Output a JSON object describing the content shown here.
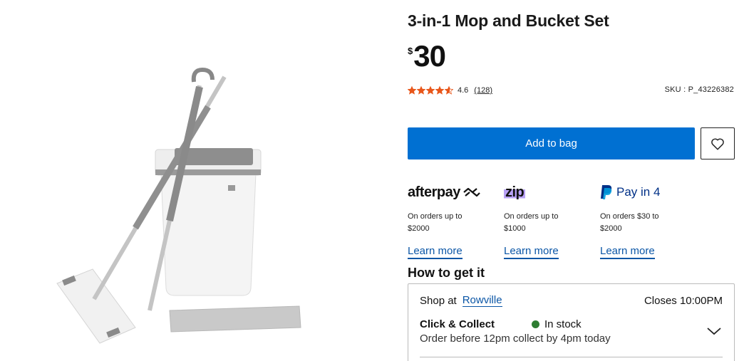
{
  "product": {
    "title": "3-in-1 Mop and Bucket Set",
    "currency_symbol": "$",
    "price": "30",
    "rating": "4.6",
    "rating_value": 4.6,
    "rating_max": 5,
    "review_count": "(128)",
    "sku": "SKU : P_43226382"
  },
  "actions": {
    "add_to_bag": "Add to bag"
  },
  "payments": [
    {
      "name": "afterpay",
      "logo_text": "afterpay",
      "description": "On orders up to $2000",
      "link": "Learn more"
    },
    {
      "name": "zip",
      "logo_text": "zip",
      "description": "On orders up to $1000",
      "link": "Learn more"
    },
    {
      "name": "paypal",
      "logo_text": "Pay in 4",
      "description": "On orders $30 to $2000",
      "link": "Learn more"
    }
  ],
  "fulfilment": {
    "heading": "How to get it",
    "shop_at": "Shop at",
    "store": "Rowville",
    "closes": "Closes 10:00PM",
    "method": "Click & Collect",
    "stock": "In stock",
    "subtext": "Order before 12pm collect by 4pm today"
  },
  "colors": {
    "primary_button": "#0070d2",
    "link": "#0b56a6",
    "star": "#e8561a",
    "in_stock": "#2e7d32"
  }
}
